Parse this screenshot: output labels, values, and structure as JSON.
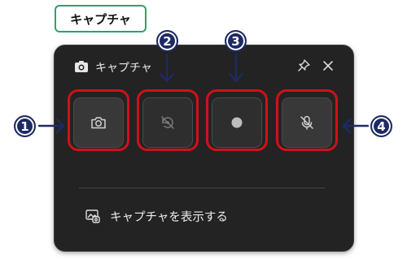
{
  "label_tag": {
    "text": "キャプチャ"
  },
  "panel": {
    "title": "キャプチャ",
    "buttons": [
      {
        "name": "screenshot",
        "icon": "camera-icon",
        "number": "1"
      },
      {
        "name": "record-last-30s",
        "icon": "history-record-icon",
        "number": "2"
      },
      {
        "name": "start-recording",
        "icon": "record-dot-icon",
        "number": "3"
      },
      {
        "name": "mic-toggle",
        "icon": "mic-off-icon",
        "number": "4"
      }
    ],
    "gallery_link": "キャプチャを表示する"
  },
  "colors": {
    "panel_bg": "#232323",
    "button_bg": "#383838",
    "highlight": "#d0101a",
    "badge": "#1d2a63",
    "tag_border": "#2aa36b"
  }
}
